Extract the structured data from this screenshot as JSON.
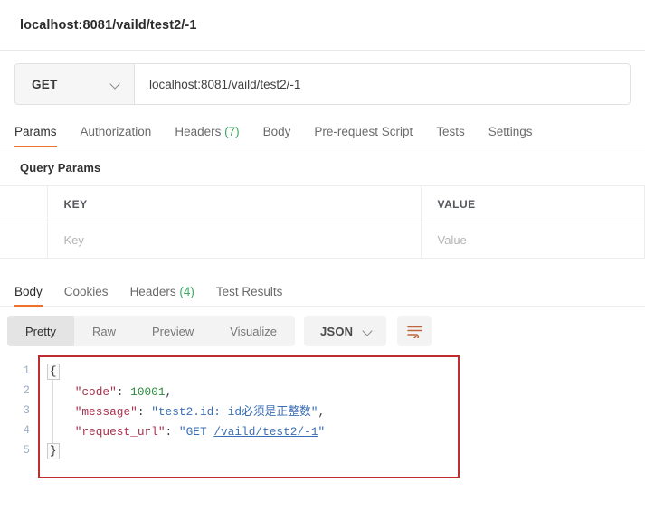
{
  "request": {
    "title": "localhost:8081/vaild/test2/-1",
    "method": "GET",
    "url": "localhost:8081/vaild/test2/-1",
    "tabs": [
      {
        "label": "Params",
        "active": true
      },
      {
        "label": "Authorization",
        "active": false
      },
      {
        "label": "Headers",
        "count": "(7)",
        "active": false
      },
      {
        "label": "Body",
        "active": false
      },
      {
        "label": "Pre-request Script",
        "active": false
      },
      {
        "label": "Tests",
        "active": false
      },
      {
        "label": "Settings",
        "active": false
      }
    ],
    "query_params": {
      "section_title": "Query Params",
      "columns": [
        "KEY",
        "VALUE"
      ],
      "rows": [
        {
          "key_placeholder": "Key",
          "value_placeholder": "Value"
        }
      ]
    }
  },
  "response": {
    "tabs": [
      {
        "label": "Body",
        "active": true
      },
      {
        "label": "Cookies",
        "active": false
      },
      {
        "label": "Headers",
        "count": "(4)",
        "active": false
      },
      {
        "label": "Test Results",
        "active": false
      }
    ],
    "view_modes": [
      {
        "label": "Pretty",
        "active": true
      },
      {
        "label": "Raw",
        "active": false
      },
      {
        "label": "Preview",
        "active": false
      },
      {
        "label": "Visualize",
        "active": false
      }
    ],
    "format": "JSON",
    "wrap_icon": "word-wrap-icon",
    "line_numbers": [
      "1",
      "2",
      "3",
      "4",
      "5"
    ],
    "body_json": {
      "open_brace": "{",
      "close_brace": "}",
      "lines": [
        {
          "key": "\"code\"",
          "colon": ": ",
          "value": "10001",
          "value_type": "number",
          "trailing": ","
        },
        {
          "key": "\"message\"",
          "colon": ": ",
          "value": "\"test2.id: id必须是正整数\"",
          "value_type": "string",
          "trailing": ","
        },
        {
          "key": "\"request_url\"",
          "colon": ": ",
          "value_prefix": "\"GET ",
          "value_link": "/vaild/test2/-1",
          "value_suffix": "\"",
          "value_type": "string-link",
          "trailing": ""
        }
      ]
    }
  },
  "colors": {
    "accent_orange": "#ef7130",
    "count_green": "#3bab62",
    "highlight_red": "#bf2c30",
    "json_key": "#a8314e",
    "json_number": "#2f8a3e",
    "json_string": "#3b6fb5"
  }
}
